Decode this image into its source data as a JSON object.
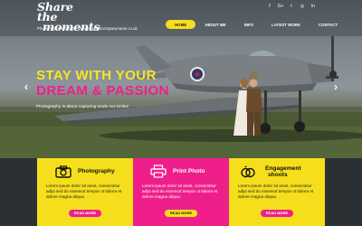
{
  "brand": {
    "logo_line1": "Share the",
    "logo_line2": "moments"
  },
  "contact": {
    "phone": "Phone: 000-0000-000",
    "email": "Email: info@companyname.co.uk"
  },
  "nav": {
    "items": [
      "HOME",
      "ABOUT ME",
      "INFO",
      "LATEST WORK",
      "CONTACT"
    ],
    "active_index": 0
  },
  "social": [
    "facebook-icon",
    "google-plus-icon",
    "twitter-icon",
    "instagram-icon",
    "linkedin-icon"
  ],
  "social_glyphs": [
    "f",
    "G+",
    "t",
    "◎",
    "in"
  ],
  "hero": {
    "headline_line1": "STAY WITH YOUR",
    "headline_line2": "DREAM & PASSION",
    "tagline": "Photography is about capturing souls not smiles",
    "prev_arrow": "‹",
    "next_arrow": "›"
  },
  "colors": {
    "yellow": "#f5df1c",
    "pink": "#ee1f8a",
    "headline_yellow": "#f6e32a"
  },
  "cards": [
    {
      "title": "Photography",
      "text": "Lorem ipsum dolor sit amet, consectetur adipi sed do eiusmod tempor ut labore et dolore magna aliqua.",
      "button": "READ MORE",
      "icon": "camera-icon"
    },
    {
      "title": "Print Photo",
      "text": "Lorem ipsum dolor sit amet, consectetur adipi sed do eiusmod tempor ut labore et dolore magna aliqua.",
      "button": "READ MORE",
      "icon": "printer-icon"
    },
    {
      "title_line1": "Engagement",
      "title_line2": "shoots",
      "text": "Lorem ipsum dolor sit amet, consectetur adipi sed do eiusmod tempor ut labore et dolore magna aliqua.",
      "button": "READ MORE",
      "icon": "rings-icon"
    }
  ]
}
